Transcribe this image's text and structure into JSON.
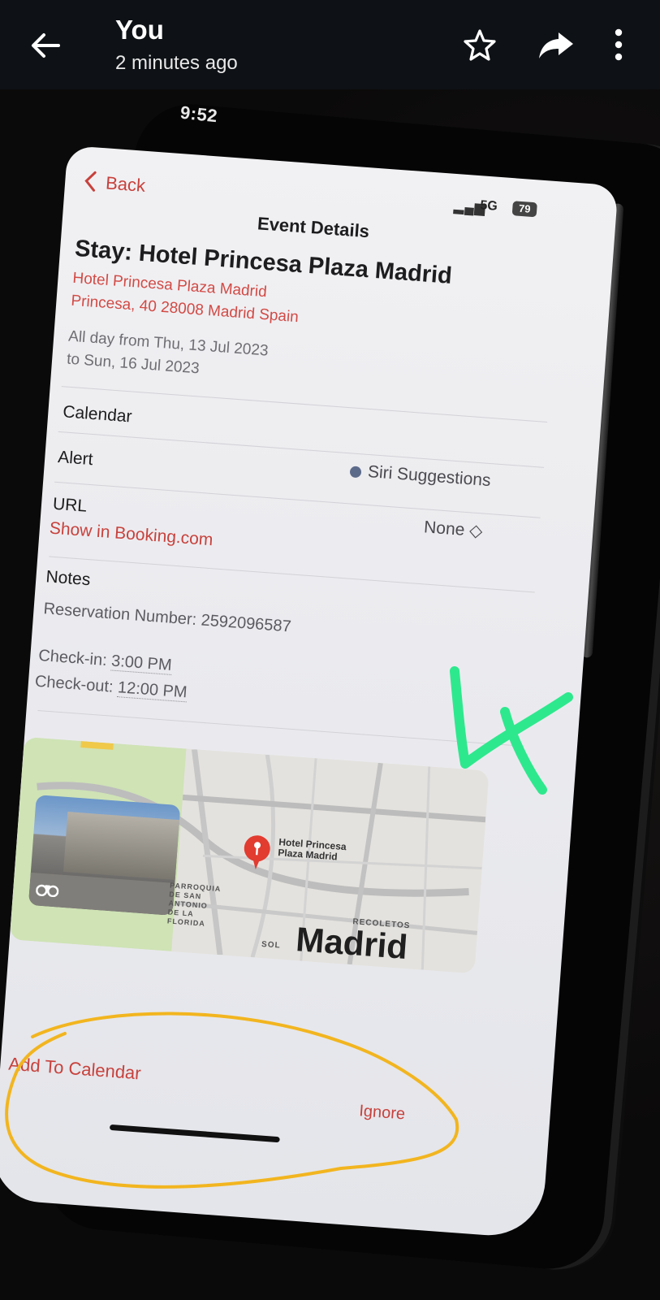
{
  "viewer": {
    "sender": "You",
    "time_ago": "2 minutes ago",
    "icons": [
      "back-arrow-icon",
      "star-icon",
      "share-icon",
      "more-options-icon"
    ]
  },
  "phone": {
    "clock": "9:52",
    "status": {
      "network": "5G",
      "battery": "79"
    }
  },
  "event": {
    "back_label": "Back",
    "nav_title": "Event Details",
    "title": "Stay: Hotel Princesa Plaza Madrid",
    "location_line1": "Hotel Princesa Plaza Madrid",
    "location_line2": "Princesa, 40 28008 Madrid Spain",
    "date_line1": "All day from Thu, 13 Jul 2023",
    "date_line2": "to Sun, 16 Jul 2023",
    "calendar_label": "Calendar",
    "calendar_value": "Siri Suggestions",
    "alert_label": "Alert",
    "alert_value": "None ◇",
    "url_label": "URL",
    "url_value": "Show in Booking.com",
    "notes_label": "Notes",
    "reservation": "Reservation Number: 2592096587",
    "checkin_label": "Check-in:",
    "checkin_time": "3:00 PM",
    "checkout_label": "Check-out:",
    "checkout_time": "12:00 PM"
  },
  "map": {
    "pin_label": "Hotel Princesa Plaza Madrid",
    "area1": "RECOLETOS",
    "area2": "SOL",
    "area3": "PARROQUIA DE SAN ANTONIO DE LA FLORIDA",
    "city": "Madrid"
  },
  "actions": {
    "add": "Add To Calendar",
    "ignore": "Ignore"
  },
  "annotation": {
    "scribble_text": "4",
    "colors": {
      "green": "#2ee88e",
      "yellow": "#f2b51f"
    }
  },
  "colors": {
    "ios_red": "#c8413c",
    "topbar": "#0e1216"
  }
}
